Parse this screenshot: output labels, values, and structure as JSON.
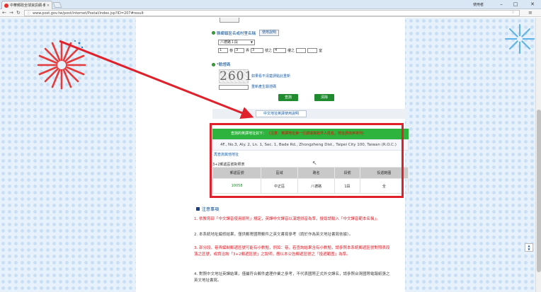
{
  "browser": {
    "tab_title": "中華郵政全球資訊網-郵遞區號查詢",
    "tab_close": "×",
    "user_label": "使用者",
    "minimize": "–",
    "maximize": "□",
    "close": "✕",
    "url": "www.post.gov.tw/post/internet/Postal/index.jsp?ID=207#result"
  },
  "form": {
    "road_section_title": "縣鄉鎮區名或村里名稱",
    "road_section_btn": "使用說明",
    "select_value": "八德路１段",
    "row": {
      "v1": "1",
      "l1": "巷",
      "v2": "3",
      "l2": "弄",
      "v3": "3",
      "l3": "號之",
      "v4": "4",
      "l4": "樓之",
      "l5": "室"
    },
    "captcha_title": "*驗證碼",
    "captcha_code": "2601",
    "captcha_link1": "如果看不清楚請點此重新",
    "captcha_link2": "重新產生驗證碼",
    "query_btn": "查詢",
    "clear_btn": "清除"
  },
  "usage_button": "中文地址英譯使用說明",
  "result": {
    "title": "查詢的英譯地址如下：",
    "warning": "(注意：英譯地址第一行請填寫收件人姓名，地址請依序排列)",
    "address_en": "4F., No.3, Aly. 2, Ln. 1, Sec. 1, Bade Rd., Zhongzheng Dist., Taipei City 100, Taiwan (R.O.C.)",
    "copy_link": "再查詢其他地址",
    "zip_title": "3+2郵遞區號對照表",
    "table": {
      "headers": [
        "郵遞區號",
        "區域",
        "路名",
        "段號",
        "投遞範圍"
      ],
      "rows": [
        [
          "10058",
          "中正區",
          "八德路",
          "1段",
          "全"
        ]
      ]
    }
  },
  "notes": {
    "title": "注意事項",
    "items": [
      "1. 依教育部「中文譯音使用原則」規定，英譯中文譯音以漢語拼音為準，搜尋請輸入「中文譯音範本名稱」。",
      "2. 本系統地址編修結果，僅供郵寄國際郵件之英文書寫參考（請於作為英文地址書寫依據）。",
      "3. 部分段、巷弄編制郵遞區號可能有小數點，例如：巷，若查詢結果含有小數點，請參照本系統郵遞區號對照表段落之區號，或請洽詢「3+2郵遞區號」之說明，應以本公告郵遞區號之「投遞範圍」為準。",
      "4. 對照中文地址英譯結果，僅屬符合郵件處理作業之參考，不代表國際正式外交譯名，請參照台灣國際電報紙張之英文地址書寫。"
    ]
  }
}
